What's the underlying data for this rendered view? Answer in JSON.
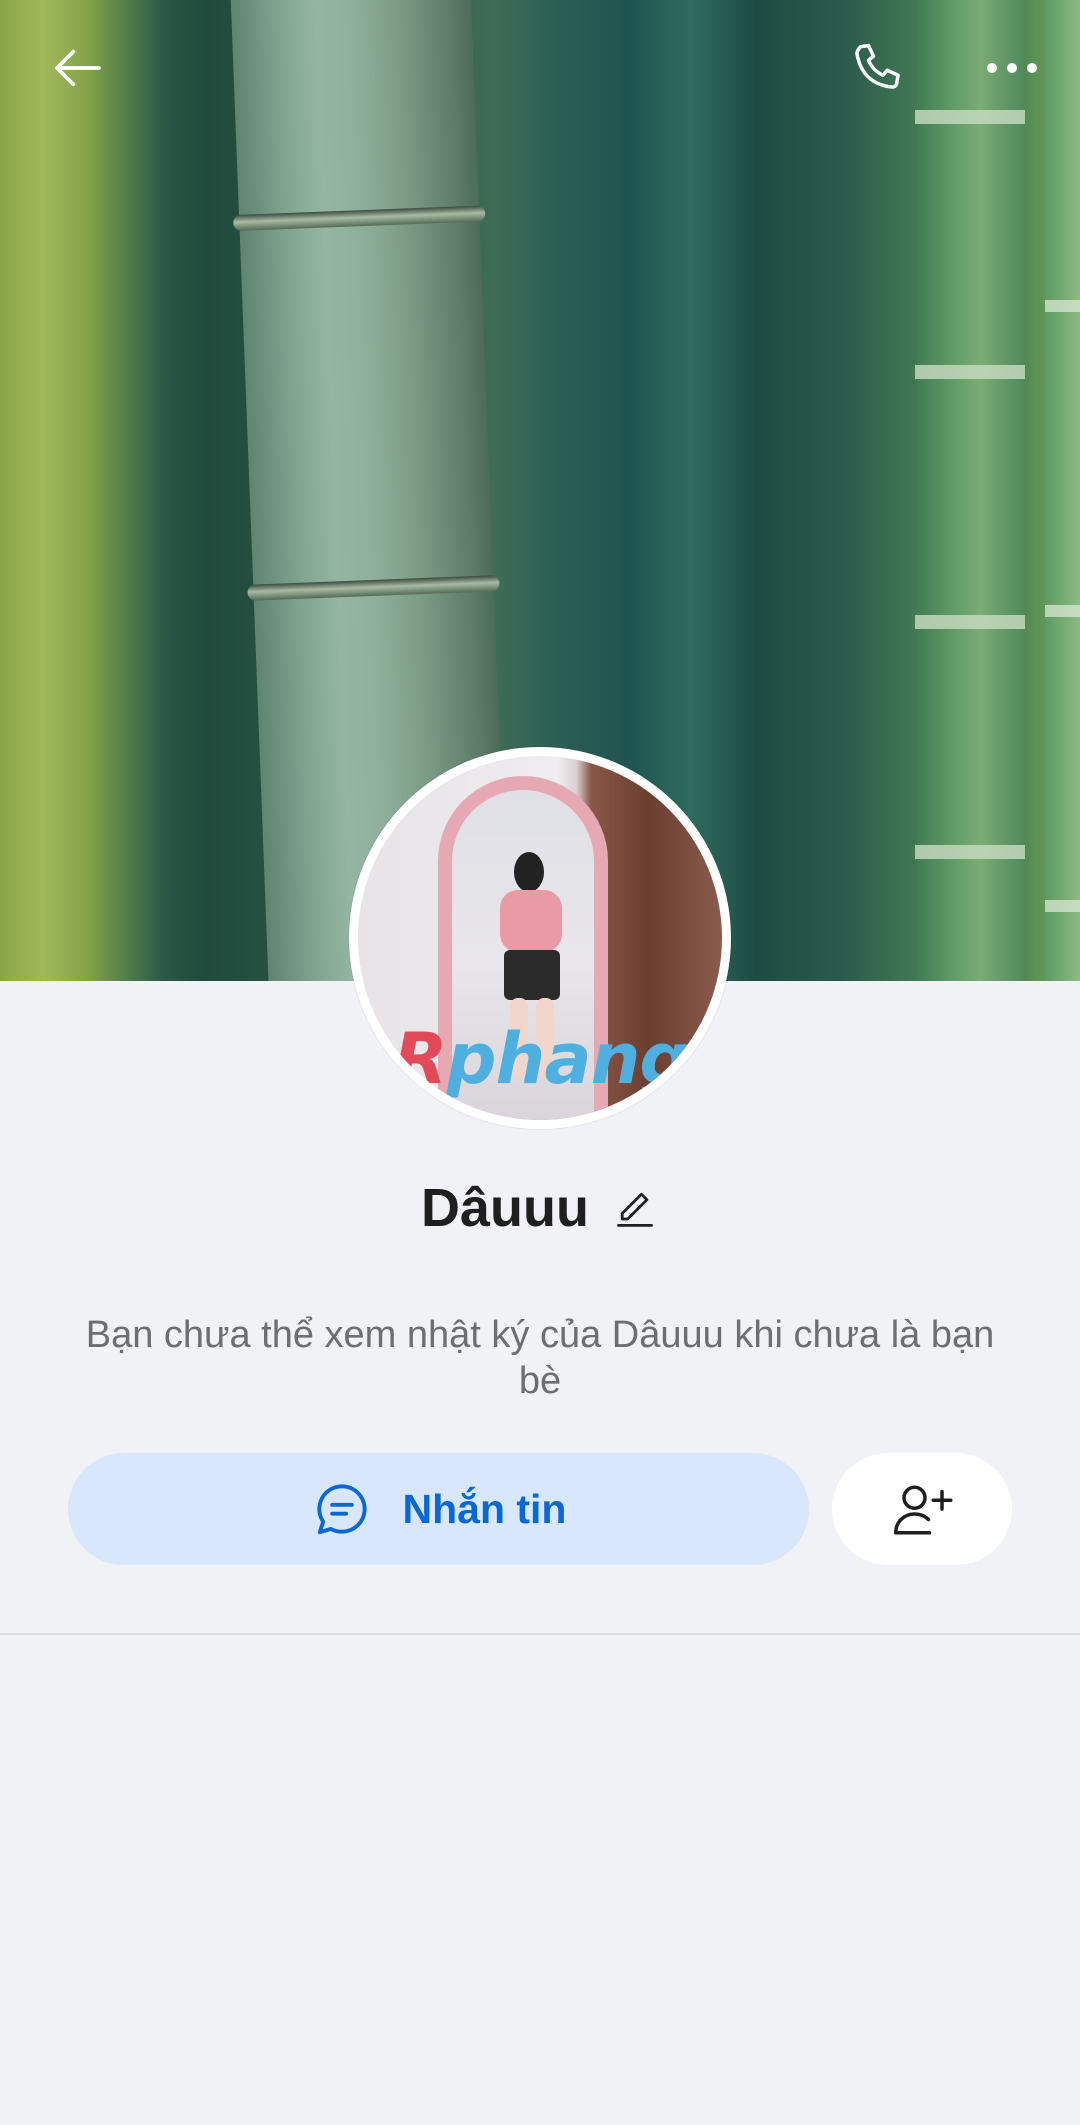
{
  "header": {
    "back_icon": "arrow-left-icon",
    "call_icon": "phone-icon",
    "more_icon": "more-horizontal-icon"
  },
  "profile": {
    "name": "Dâuuu",
    "avatar_watermark": "Rphang",
    "edit_icon": "pencil-icon"
  },
  "notice": {
    "text": "Bạn chưa thể xem nhật ký của Dâuuu khi chưa là bạn bè"
  },
  "actions": {
    "message_label": "Nhắn tin",
    "message_icon": "chat-bubble-icon",
    "add_friend_icon": "user-plus-icon"
  },
  "colors": {
    "accent": "#0a68d6",
    "message_button_bg": "#d8e7fb",
    "page_bg": "#f0f2f5"
  }
}
